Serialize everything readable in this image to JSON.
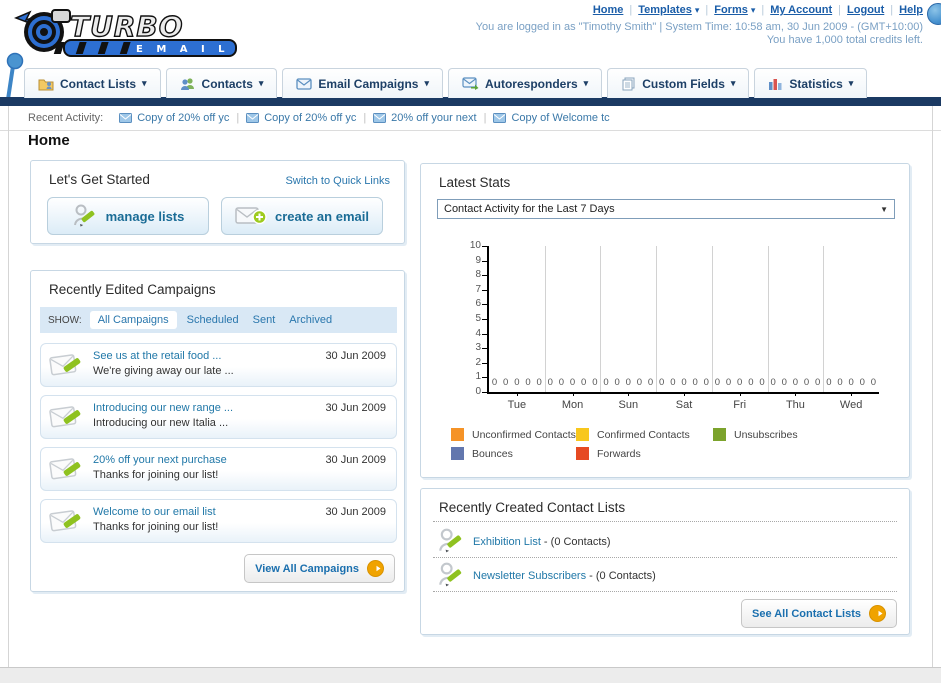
{
  "header": {
    "sep": "|",
    "caret": "▾",
    "logo_title": "TURBO",
    "logo_subtitle": "E M A I L",
    "nav_links": [
      {
        "label": "Home"
      },
      {
        "label": "Templates",
        "dropdown": true
      },
      {
        "label": "Forms",
        "dropdown": true
      },
      {
        "label": "My Account"
      },
      {
        "label": "Logout"
      },
      {
        "label": "Help"
      }
    ],
    "login_info": "You are logged in as \"Timothy Smith\" | System Time: 10:58 am, 30 Jun 2009 - (GMT+10:00)",
    "credits_info": "You have 1,000 total credits left."
  },
  "tabs": [
    {
      "label": "Contact Lists",
      "icon": "folder-user-icon"
    },
    {
      "label": "Contacts",
      "icon": "users-icon"
    },
    {
      "label": "Email Campaigns",
      "icon": "envelope-icon"
    },
    {
      "label": "Autoresponders",
      "icon": "envelope-arrow-icon"
    },
    {
      "label": "Custom Fields",
      "icon": "pages-icon"
    },
    {
      "label": "Statistics",
      "icon": "bar-chart-icon"
    }
  ],
  "recent_activity": {
    "label": "Recent Activity:",
    "items": [
      "Copy of 20% off yc",
      "Copy of 20% off yc",
      "20% off your next",
      "Copy of Welcome tc"
    ]
  },
  "page_title": "Home",
  "get_started": {
    "title": "Let's Get Started",
    "switch_link": "Switch to Quick Links",
    "buttons": [
      {
        "label": "manage lists",
        "icon": "person-pencil-icon"
      },
      {
        "label": "create an email",
        "icon": "envelope-plus-icon"
      }
    ]
  },
  "campaigns": {
    "title": "Recently Edited Campaigns",
    "show_label": "SHOW:",
    "filters": [
      "All Campaigns",
      "Scheduled",
      "Sent",
      "Archived"
    ],
    "active_filter": "All Campaigns",
    "items": [
      {
        "title": "See us at the retail food ...",
        "subtitle": "We're giving away our late ...",
        "date": "30 Jun 2009"
      },
      {
        "title": "Introducing our new range ...",
        "subtitle": "Introducing our new Italia ...",
        "date": "30 Jun 2009"
      },
      {
        "title": "20% off your next purchase",
        "subtitle": "Thanks for joining our list!",
        "date": "30 Jun 2009"
      },
      {
        "title": "Welcome to our email list",
        "subtitle": "Thanks for joining our list!",
        "date": "30 Jun 2009"
      }
    ],
    "view_all_label": "View All Campaigns"
  },
  "latest_stats": {
    "title": "Latest Stats",
    "dropdown_value": "Contact Activity for the Last 7 Days",
    "dropdown_arrow": "▼",
    "chart_data": {
      "type": "bar",
      "title": "Contact Activity for the Last 7 Days",
      "categories": [
        "Tue",
        "Mon",
        "Sun",
        "Sat",
        "Fri",
        "Thu",
        "Wed"
      ],
      "series": [
        {
          "name": "Unconfirmed Contacts",
          "color": "#f59327",
          "values": [
            0,
            0,
            0,
            0,
            0,
            0,
            0
          ]
        },
        {
          "name": "Confirmed Contacts",
          "color": "#f8c71c",
          "values": [
            0,
            0,
            0,
            0,
            0,
            0,
            0
          ]
        },
        {
          "name": "Unsubscribes",
          "color": "#7ca32c",
          "values": [
            0,
            0,
            0,
            0,
            0,
            0,
            0
          ]
        },
        {
          "name": "Bounces",
          "color": "#6377ae",
          "values": [
            0,
            0,
            0,
            0,
            0,
            0,
            0
          ]
        },
        {
          "name": "Forwards",
          "color": "#e64a22",
          "values": [
            0,
            0,
            0,
            0,
            0,
            0,
            0
          ]
        }
      ],
      "ylim": [
        0,
        10
      ],
      "yticks": [
        0,
        1,
        2,
        3,
        4,
        5,
        6,
        7,
        8,
        9,
        10
      ],
      "grid": true,
      "legend_position": "bottom",
      "show_value_labels": true
    }
  },
  "contact_lists": {
    "title": "Recently Created Contact Lists",
    "items": [
      {
        "name": "Exhibition List",
        "detail": " - (0 Contacts)"
      },
      {
        "name": "Newsletter Subscribers",
        "detail": " - (0 Contacts)"
      }
    ],
    "see_all_label": "See All Contact Lists"
  },
  "colors": {
    "navy_bar": "#1b3a63",
    "link_blue": "#2a77ad",
    "header_link": "#1a5da8",
    "login_text": "#7aa0c4",
    "button_text": "#1a6c96",
    "arrow_circle": "#f0a300",
    "show_bar_bg": "#d9e8f5"
  }
}
